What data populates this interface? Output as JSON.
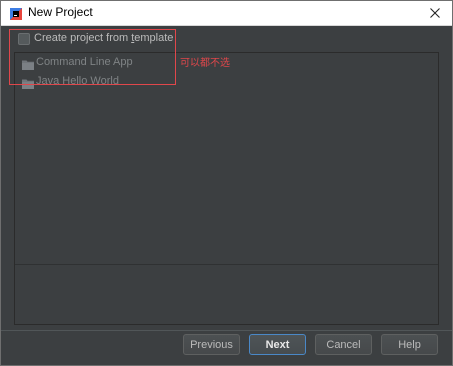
{
  "window": {
    "title": "New Project"
  },
  "options": {
    "create_from_template_prefix": "Create project from ",
    "create_from_template_key": "t",
    "create_from_template_suffix": "emplate",
    "checked": false
  },
  "templates": [
    {
      "label": "Command Line App",
      "icon": "folder-icon"
    },
    {
      "label": "Java Hello World",
      "icon": "folder-icon"
    }
  ],
  "annotation": {
    "text": "可以都不选",
    "color": "#e0474b"
  },
  "buttons": {
    "previous": "Previous",
    "next": "Next",
    "cancel": "Cancel",
    "help": "Help"
  },
  "colors": {
    "background": "#3c3f41",
    "accent": "#4a88c7",
    "annotation": "#e0474b"
  }
}
